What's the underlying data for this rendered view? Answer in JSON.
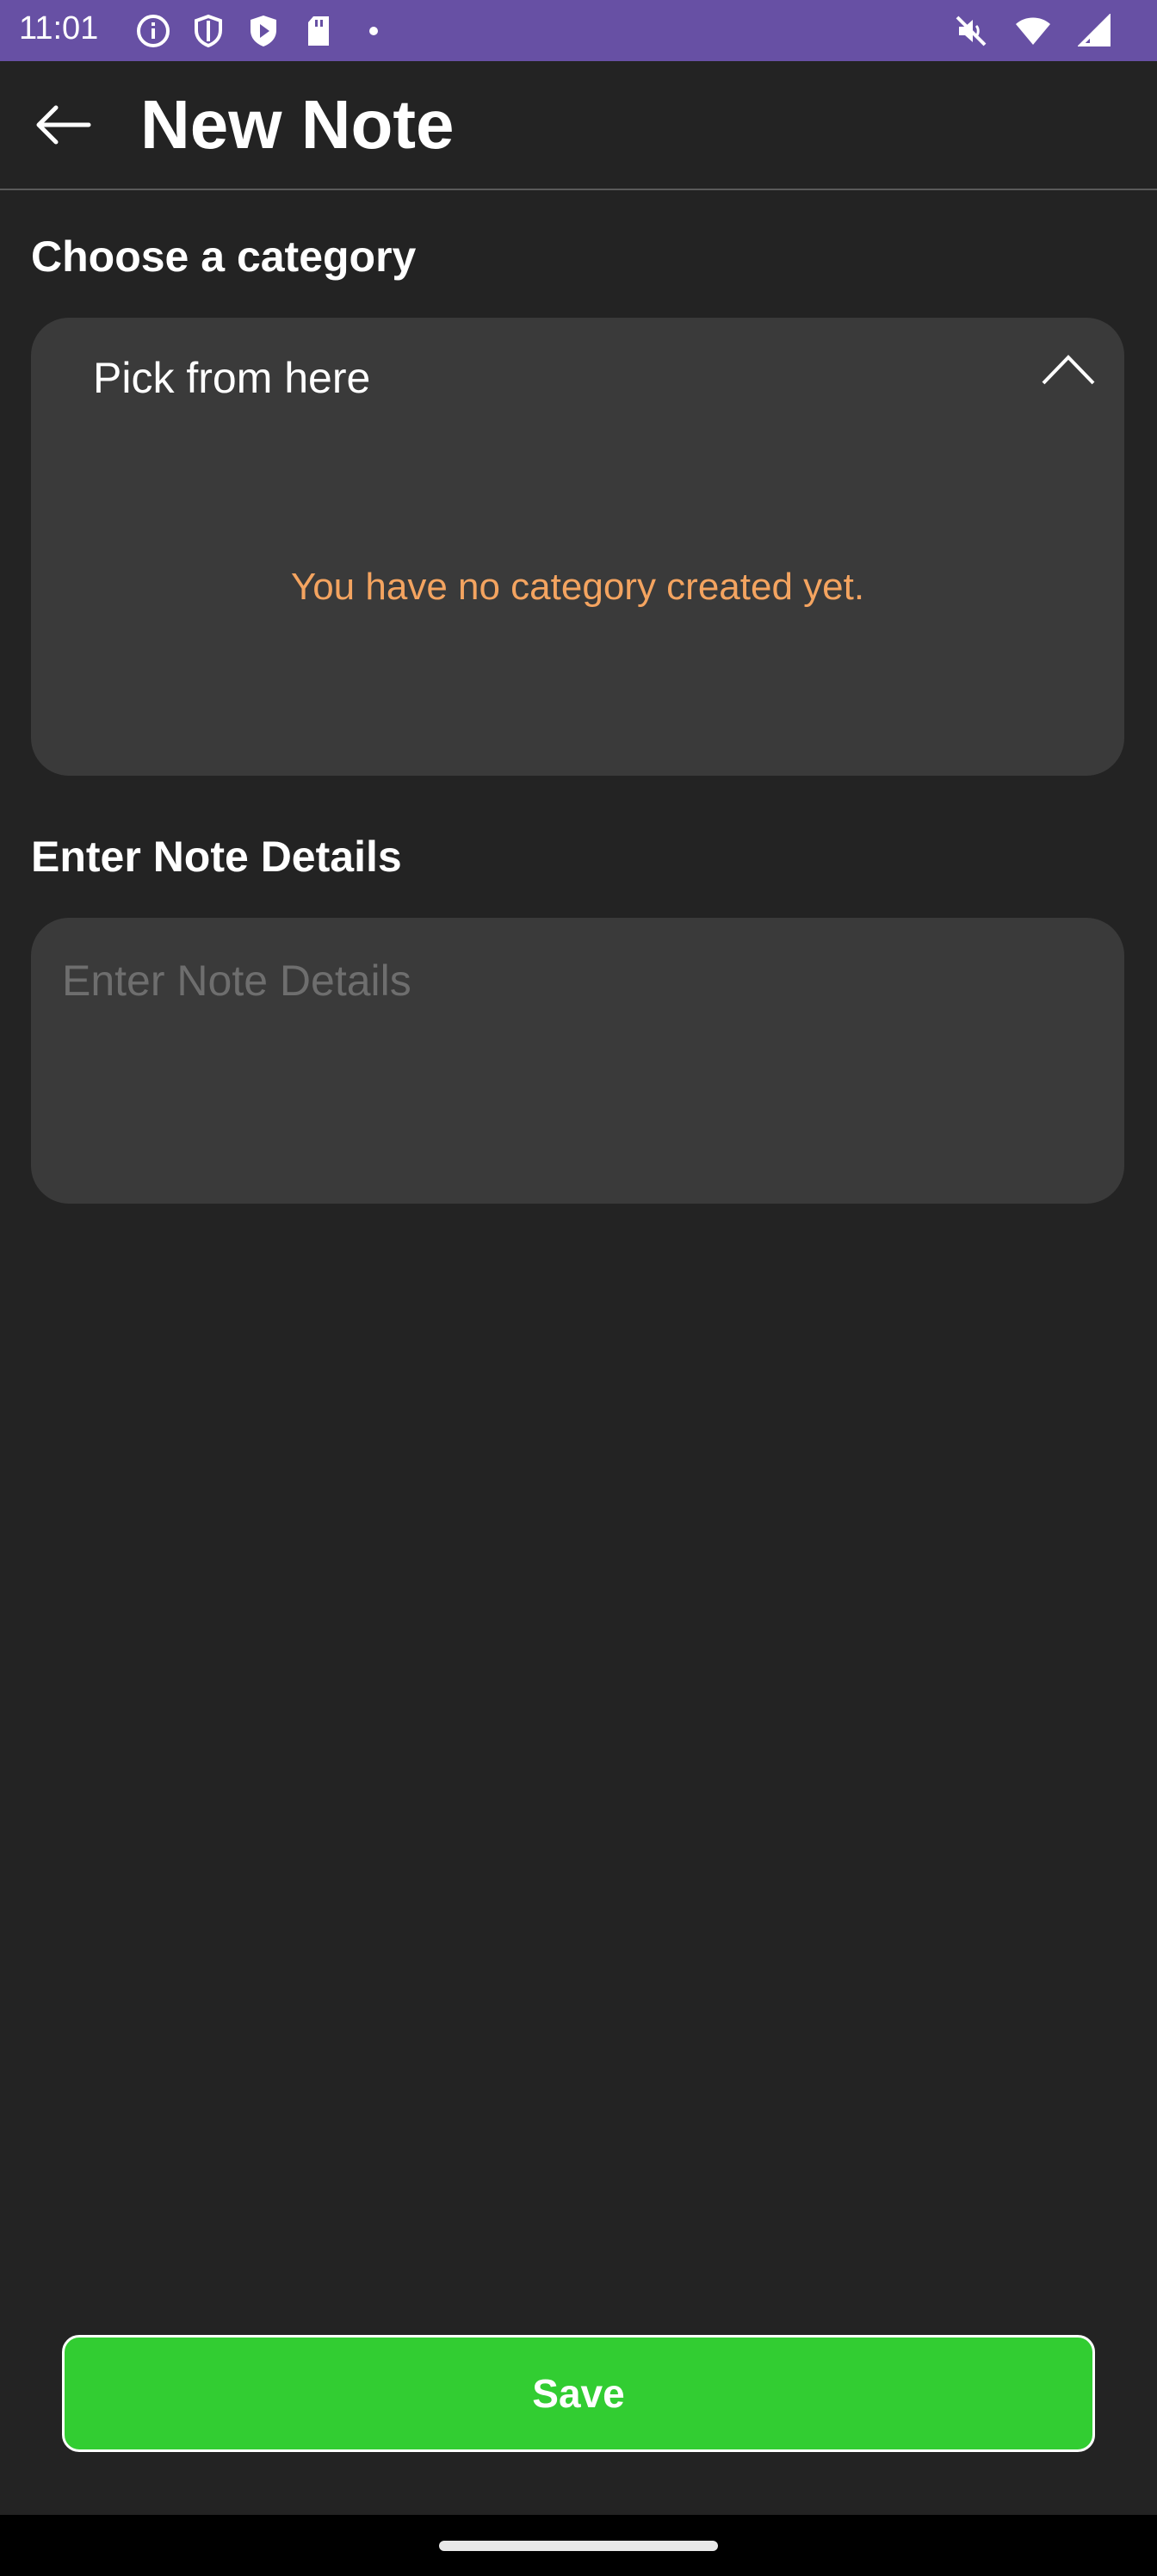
{
  "status_bar": {
    "time": "11:01",
    "background": "#6750A4",
    "left_icons": [
      "info-icon",
      "shield-icon",
      "play-shield-icon",
      "sd-card-icon",
      "notification-dot-icon"
    ],
    "right_icons": [
      "mute-icon",
      "wifi-icon",
      "signal-icon"
    ]
  },
  "app_bar": {
    "title": "New Note",
    "back_icon": "arrow-left-icon"
  },
  "category": {
    "label": "Choose a category",
    "dropdown_value": "Pick from here",
    "empty_message": "You have no category created yet.",
    "empty_message_color": "#F4A460",
    "chevron_icon": "chevron-up-icon"
  },
  "note": {
    "label": "Enter Note Details",
    "placeholder": "Enter Note Details",
    "value": ""
  },
  "save_button": {
    "label": "Save",
    "color": "#32CD32"
  }
}
